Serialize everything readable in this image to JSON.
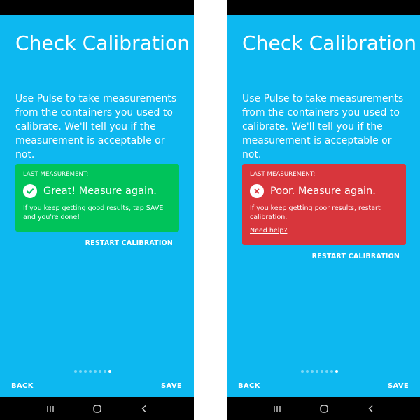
{
  "screens": [
    {
      "title": "Check Calibration",
      "intro": "Use Pulse to take measurements from the containers you used to calibrate. We'll tell you if the measurement is acceptable or not.",
      "card": {
        "caption": "LAST MEASUREMENT:",
        "status_icon": "check-circle-icon",
        "status_text": "Great! Measure again.",
        "detail": "If you keep getting good results, tap SAVE and you're done!",
        "color": "#00c35a"
      },
      "restart_label": "RESTART CALIBRATION",
      "pager": {
        "total": 8,
        "current": 8
      },
      "back_label": "BACK",
      "save_label": "SAVE"
    },
    {
      "title": "Check Calibration",
      "intro": "Use Pulse to take measurements from the containers you used to calibrate. We'll tell you if the measurement is acceptable or not.",
      "card": {
        "caption": "LAST MEASUREMENT:",
        "status_icon": "x-circle-icon",
        "status_text": "Poor. Measure again.",
        "detail": "If you keep getting poor results, restart calibration.",
        "help_link": "Need help?",
        "color": "#d8363c"
      },
      "restart_label": "RESTART CALIBRATION",
      "pager": {
        "total": 8,
        "current": 8
      },
      "back_label": "BACK",
      "save_label": "SAVE"
    }
  ],
  "theme": {
    "background": "#0db8f0",
    "good": "#00c35a",
    "poor": "#d8363c"
  },
  "system_nav": {
    "icons": [
      "recent-apps-icon",
      "home-icon",
      "back-icon"
    ]
  }
}
